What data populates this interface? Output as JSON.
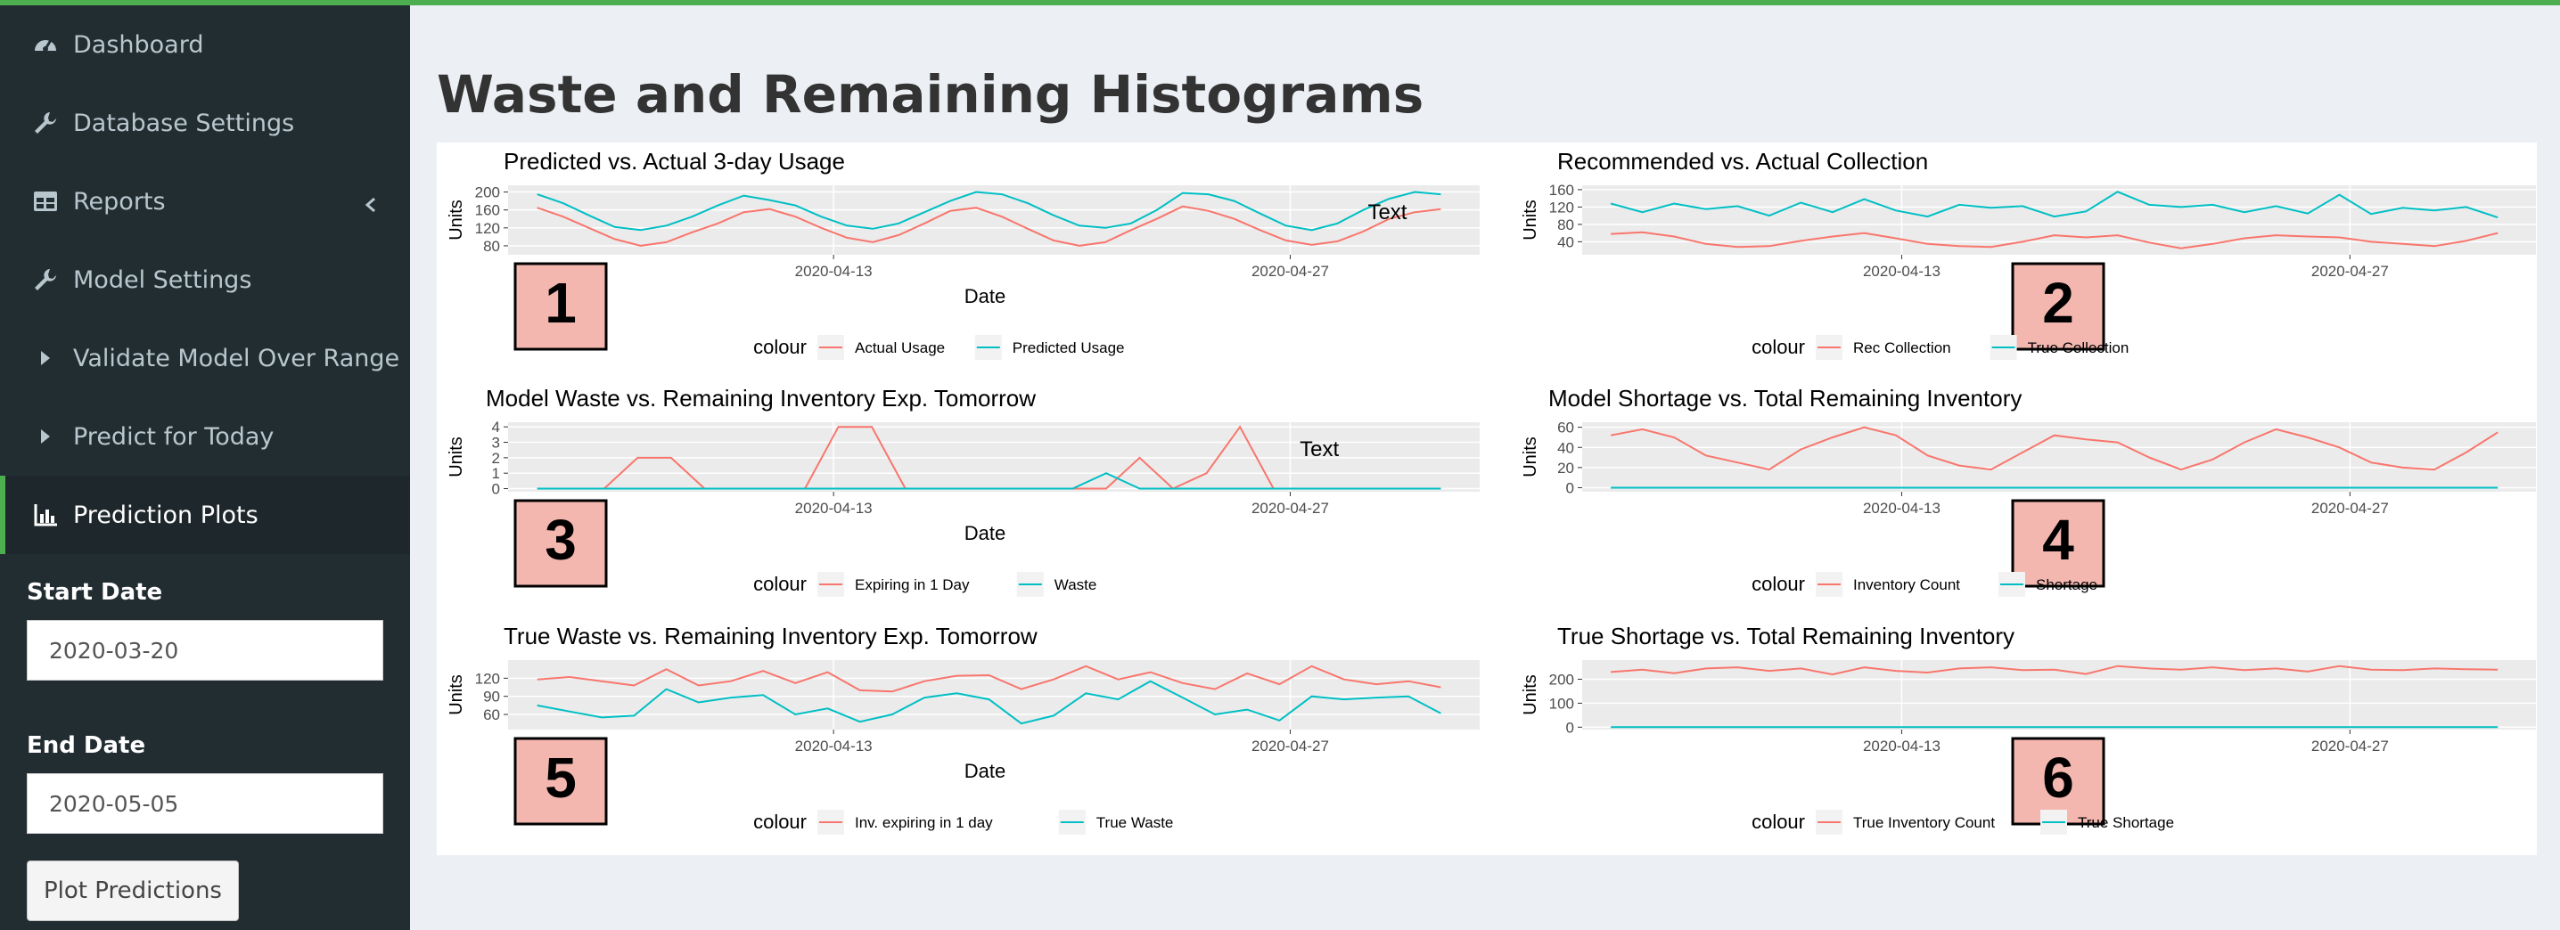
{
  "colors": {
    "green": "#4cae4f",
    "sidebar": "#222d32",
    "red_series": "#f8766d",
    "cyan_series": "#00bfc4",
    "badge_bg": "#f4b7b0"
  },
  "sidebar": {
    "items": [
      {
        "label": "Dashboard",
        "icon": "dashboard-icon"
      },
      {
        "label": "Database Settings",
        "icon": "wrench-icon"
      },
      {
        "label": "Reports",
        "icon": "table-icon"
      },
      {
        "label": "Model Settings",
        "icon": "wrench-icon"
      },
      {
        "label": "Validate Model Over Range",
        "icon": "caret-right-icon"
      },
      {
        "label": "Predict for Today",
        "icon": "caret-right-icon"
      },
      {
        "label": "Prediction Plots",
        "icon": "bar-chart-icon"
      }
    ],
    "start_date_label": "Start Date",
    "start_date_value": "2020-03-20",
    "end_date_label": "End Date",
    "end_date_value": "2020-05-05",
    "plot_button": "Plot Predictions"
  },
  "page_title": "Waste and Remaining Histograms",
  "chart_data": [
    {
      "type": "line",
      "badge": "1",
      "title": "Predicted vs. Actual 3-day Usage",
      "ylabel": "Units",
      "xlabel": "Date",
      "x_ticks": [
        "2020-04-13",
        "2020-04-27"
      ],
      "y_ticks": [
        80,
        120,
        160,
        200
      ],
      "ylim": [
        60,
        215
      ],
      "annotation": "Text",
      "legend_title": "colour",
      "series": [
        {
          "name": "Actual Usage",
          "color": "#f8766d",
          "values": [
            165,
            145,
            120,
            95,
            80,
            88,
            110,
            130,
            155,
            162,
            145,
            120,
            98,
            88,
            104,
            130,
            158,
            165,
            145,
            118,
            92,
            80,
            88,
            115,
            140,
            168,
            158,
            140,
            115,
            92,
            82,
            90,
            112,
            140,
            155,
            162
          ]
        },
        {
          "name": "Predicted Usage",
          "color": "#00bfc4",
          "values": [
            195,
            175,
            148,
            122,
            115,
            125,
            145,
            170,
            192,
            182,
            170,
            145,
            125,
            118,
            130,
            155,
            180,
            200,
            195,
            175,
            148,
            125,
            120,
            130,
            160,
            198,
            195,
            180,
            152,
            125,
            115,
            130,
            160,
            185,
            200,
            195
          ]
        }
      ]
    },
    {
      "type": "line",
      "badge": "2",
      "title": "Recommended vs. Actual Collection",
      "ylabel": "Units",
      "xlabel": "Date",
      "x_ticks": [
        "2020-04-13",
        "2020-04-27"
      ],
      "y_ticks": [
        40,
        80,
        120,
        160
      ],
      "ylim": [
        10,
        170
      ],
      "annotation": "",
      "legend_title": "colour",
      "series": [
        {
          "name": "Rec Collection",
          "color": "#f8766d",
          "values": [
            58,
            62,
            52,
            35,
            28,
            30,
            42,
            52,
            60,
            48,
            35,
            30,
            28,
            40,
            55,
            50,
            55,
            38,
            25,
            35,
            48,
            55,
            52,
            50,
            40,
            35,
            30,
            42,
            60
          ]
        },
        {
          "name": "True Collection",
          "color": "#00bfc4",
          "values": [
            128,
            108,
            128,
            115,
            122,
            100,
            130,
            108,
            138,
            112,
            98,
            125,
            118,
            122,
            98,
            110,
            155,
            125,
            120,
            125,
            108,
            122,
            105,
            148,
            104,
            118,
            112,
            120,
            96
          ]
        }
      ]
    },
    {
      "type": "line",
      "badge": "3",
      "title": "Model Waste vs. Remaining Inventory Exp. Tomorrow",
      "ylabel": "Units",
      "xlabel": "Date",
      "x_ticks": [
        "2020-04-13",
        "2020-04-27"
      ],
      "y_ticks": [
        0,
        1,
        2,
        3,
        4
      ],
      "ylim": [
        -0.2,
        4.3
      ],
      "annotation": "Text",
      "legend_title": "colour",
      "series": [
        {
          "name": "Expiring in 1 Day",
          "color": "#f8766d",
          "values": [
            0,
            0,
            0,
            2,
            2,
            0,
            0,
            0,
            0,
            4,
            4,
            0,
            0,
            0,
            0,
            0,
            0,
            0,
            2,
            0,
            1,
            4,
            0,
            0,
            0,
            0,
            0,
            0
          ]
        },
        {
          "name": "Waste",
          "color": "#00bfc4",
          "values": [
            0,
            0,
            0,
            0,
            0,
            0,
            0,
            0,
            0,
            0,
            0,
            0,
            0,
            0,
            0,
            0,
            0,
            1,
            0,
            0,
            0,
            0,
            0,
            0,
            0,
            0,
            0,
            0
          ]
        }
      ]
    },
    {
      "type": "line",
      "badge": "4",
      "title": "Model Shortage vs. Total Remaining Inventory",
      "ylabel": "Units",
      "xlabel": "Date",
      "x_ticks": [
        "2020-04-13",
        "2020-04-27"
      ],
      "y_ticks": [
        0,
        20,
        40,
        60
      ],
      "ylim": [
        -4,
        65
      ],
      "annotation": "",
      "legend_title": "colour",
      "series": [
        {
          "name": "Inventory Count",
          "color": "#f8766d",
          "values": [
            52,
            58,
            50,
            32,
            25,
            18,
            38,
            50,
            60,
            52,
            32,
            22,
            18,
            35,
            52,
            48,
            45,
            30,
            18,
            28,
            45,
            58,
            50,
            40,
            25,
            20,
            18,
            35,
            55
          ]
        },
        {
          "name": "Shortage",
          "color": "#00bfc4",
          "values": [
            0,
            0,
            0,
            0,
            0,
            0,
            0,
            0,
            0,
            0,
            0,
            0,
            0,
            0,
            0,
            0,
            0,
            0,
            0,
            0,
            0,
            0,
            0,
            0,
            0,
            0,
            0,
            0,
            0
          ]
        }
      ]
    },
    {
      "type": "line",
      "badge": "5",
      "title": "True Waste vs. Remaining Inventory Exp. Tomorrow",
      "ylabel": "Units",
      "xlabel": "Date",
      "x_ticks": [
        "2020-04-13",
        "2020-04-27"
      ],
      "y_ticks": [
        60,
        90,
        120
      ],
      "ylim": [
        35,
        150
      ],
      "annotation": "",
      "legend_title": "colour",
      "series": [
        {
          "name": "Inv. expiring in 1 day",
          "color": "#f8766d",
          "values": [
            118,
            122,
            115,
            108,
            135,
            108,
            115,
            132,
            112,
            130,
            100,
            98,
            115,
            124,
            125,
            102,
            118,
            140,
            118,
            130,
            112,
            102,
            128,
            110,
            140,
            118,
            110,
            115,
            105
          ]
        },
        {
          "name": "True Waste",
          "color": "#00bfc4",
          "values": [
            75,
            65,
            55,
            58,
            102,
            80,
            88,
            92,
            60,
            70,
            48,
            60,
            88,
            95,
            85,
            45,
            58,
            95,
            85,
            115,
            88,
            60,
            68,
            50,
            90,
            85,
            88,
            90,
            62
          ]
        }
      ]
    },
    {
      "type": "line",
      "badge": "6",
      "title": "True Shortage vs. Total Remaining Inventory",
      "ylabel": "Units",
      "xlabel": "Date",
      "x_ticks": [
        "2020-04-13",
        "2020-04-27"
      ],
      "y_ticks": [
        0,
        100,
        200
      ],
      "ylim": [
        -10,
        280
      ],
      "annotation": "",
      "legend_title": "colour",
      "series": [
        {
          "name": "True Inventory Count",
          "color": "#f8766d",
          "values": [
            230,
            240,
            225,
            245,
            250,
            235,
            245,
            220,
            250,
            235,
            228,
            245,
            250,
            238,
            240,
            222,
            255,
            245,
            240,
            250,
            238,
            245,
            232,
            255,
            240,
            238,
            245,
            242,
            240
          ]
        },
        {
          "name": "True Shortage",
          "color": "#00bfc4",
          "values": [
            0,
            0,
            0,
            0,
            0,
            0,
            0,
            0,
            0,
            0,
            0,
            0,
            0,
            0,
            0,
            0,
            0,
            0,
            0,
            0,
            0,
            0,
            0,
            0,
            0,
            0,
            0,
            0,
            0
          ]
        }
      ]
    }
  ]
}
